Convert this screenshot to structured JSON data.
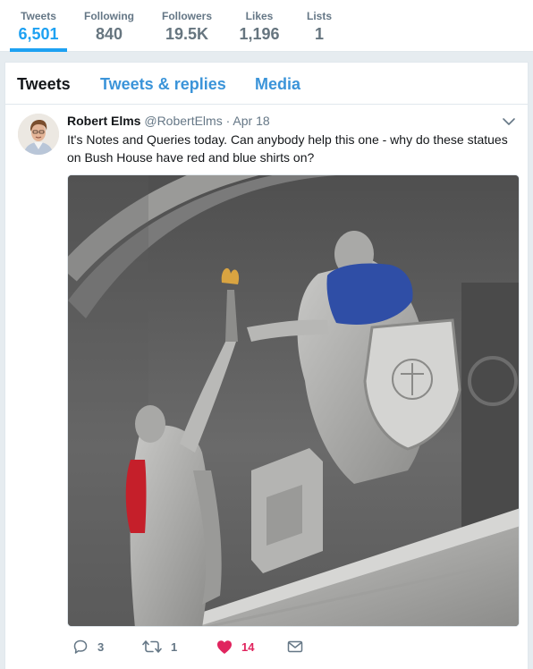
{
  "stats": [
    {
      "label": "Tweets",
      "value": "6,501"
    },
    {
      "label": "Following",
      "value": "840"
    },
    {
      "label": "Followers",
      "value": "19.5K"
    },
    {
      "label": "Likes",
      "value": "1,196"
    },
    {
      "label": "Lists",
      "value": "1"
    }
  ],
  "tabs": [
    {
      "label": "Tweets"
    },
    {
      "label": "Tweets & replies"
    },
    {
      "label": "Media"
    }
  ],
  "tweet": {
    "fullname": "Robert Elms",
    "username": "@RobertElms",
    "separator": "·",
    "time": "Apr 18",
    "text": "It's Notes and Queries today. Can anybody help this one - why do these statues on Bush House have red and blue shirts on?",
    "actions": {
      "reply_count": "3",
      "retweet_count": "1",
      "like_count": "14"
    }
  },
  "colors": {
    "accent": "#1da1f2",
    "link": "#3b94d9",
    "like": "#e0245e",
    "muted": "#657786"
  },
  "icons": {
    "reply": "reply-icon",
    "retweet": "retweet-icon",
    "like": "heart-icon",
    "dm": "envelope-icon",
    "caret": "chevron-down-icon"
  }
}
